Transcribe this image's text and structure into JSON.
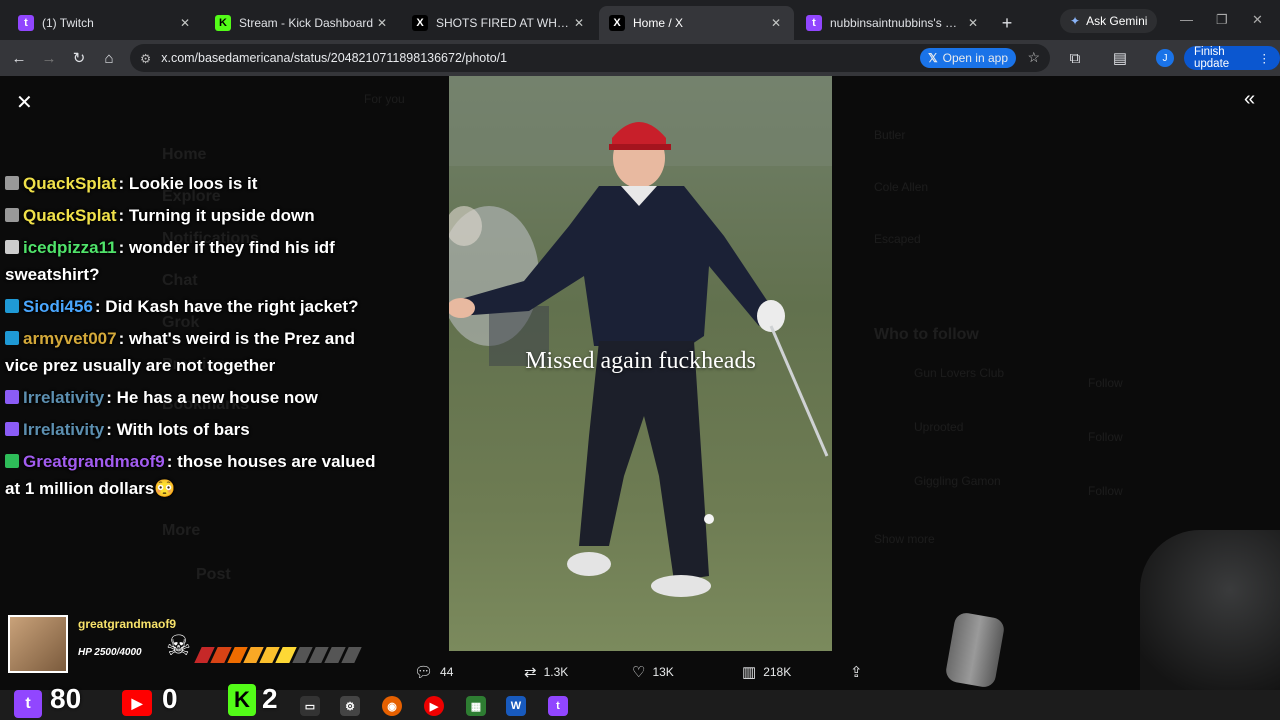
{
  "tabs": [
    {
      "title": "(1) Twitch",
      "fav": "twitch",
      "color": "#9146ff",
      "glyph": "t"
    },
    {
      "title": "Stream - Kick Dashboard",
      "fav": "kick",
      "color": "#53fc18",
      "glyph": "K"
    },
    {
      "title": "SHOTS FIRED AT WH DINNER \\",
      "fav": "x",
      "color": "#000000",
      "glyph": "X"
    },
    {
      "title": "Home / X",
      "fav": "x",
      "color": "#000000",
      "glyph": "X"
    },
    {
      "title": "nubbinsaintnubbins's Mod View",
      "fav": "twitch",
      "color": "#9146ff",
      "glyph": "t"
    }
  ],
  "browser": {
    "url": "x.com/basedamericana/status/2048210711898136672/photo/1",
    "open_in_app": "Open in app",
    "ask_gemini": "Ask Gemini",
    "finish_update": "Finish update",
    "profile_initial": "J"
  },
  "photo": {
    "caption": "Missed again fuckheads"
  },
  "engagement": {
    "replies": "44",
    "reposts": "1.3K",
    "likes": "13K",
    "views": "218K"
  },
  "background_ghost": {
    "sidebar": [
      "Home",
      "Explore",
      "Notifications",
      "Chat",
      "Grok",
      "Premium",
      "Bookmarks",
      "More",
      "Post"
    ],
    "feed_tab": "For you",
    "right_rail": [
      "Butler",
      "Cole Allen",
      "Escaped",
      "Who to follow",
      "Gun Lovers Club",
      "Uprooted",
      "Giggling Gamon",
      "Show more"
    ],
    "follow_label": "Follow"
  },
  "chat": [
    {
      "user": "QuackSplat",
      "color": "#f0e14a",
      "text": ": Lookie loos is it",
      "badge": "#999999"
    },
    {
      "user": "QuackSplat",
      "color": "#f0e14a",
      "text": ": Turning it upside down",
      "badge": "#999999"
    },
    {
      "user": "icedpizza11",
      "color": "#50e36a",
      "text": ": wonder if they find his idf sweatshirt?",
      "badge": "#cccccc"
    },
    {
      "user": "Siodi456",
      "color": "#4aa7ff",
      "text": ": Did Kash have the right jacket?",
      "badge": "#1f9ad6"
    },
    {
      "user": "armyvet007",
      "color": "#d4a93a",
      "text": ": what's weird is the Prez and vice prez usually are not together",
      "badge": "#1f9ad6"
    },
    {
      "user": "Irrelativity",
      "color": "#5c8fb0",
      "text": ": He has a new house now",
      "badge": "#8b5cf6"
    },
    {
      "user": "Irrelativity",
      "color": "#5c8fb0",
      "text": ": With lots of bars",
      "badge": "#8b5cf6"
    },
    {
      "user": "Greatgrandmaof9",
      "color": "#a25cf0",
      "text": ": those houses are valued at 1 million dollars😳",
      "badge": "#2ebd59"
    }
  ],
  "overlay": {
    "username": "greatgrandmaof9",
    "hp": "HP 2500/4000",
    "hp_fraction": 0.625,
    "twitch_count": "80",
    "youtube_count": "0",
    "kick_count": "2"
  }
}
